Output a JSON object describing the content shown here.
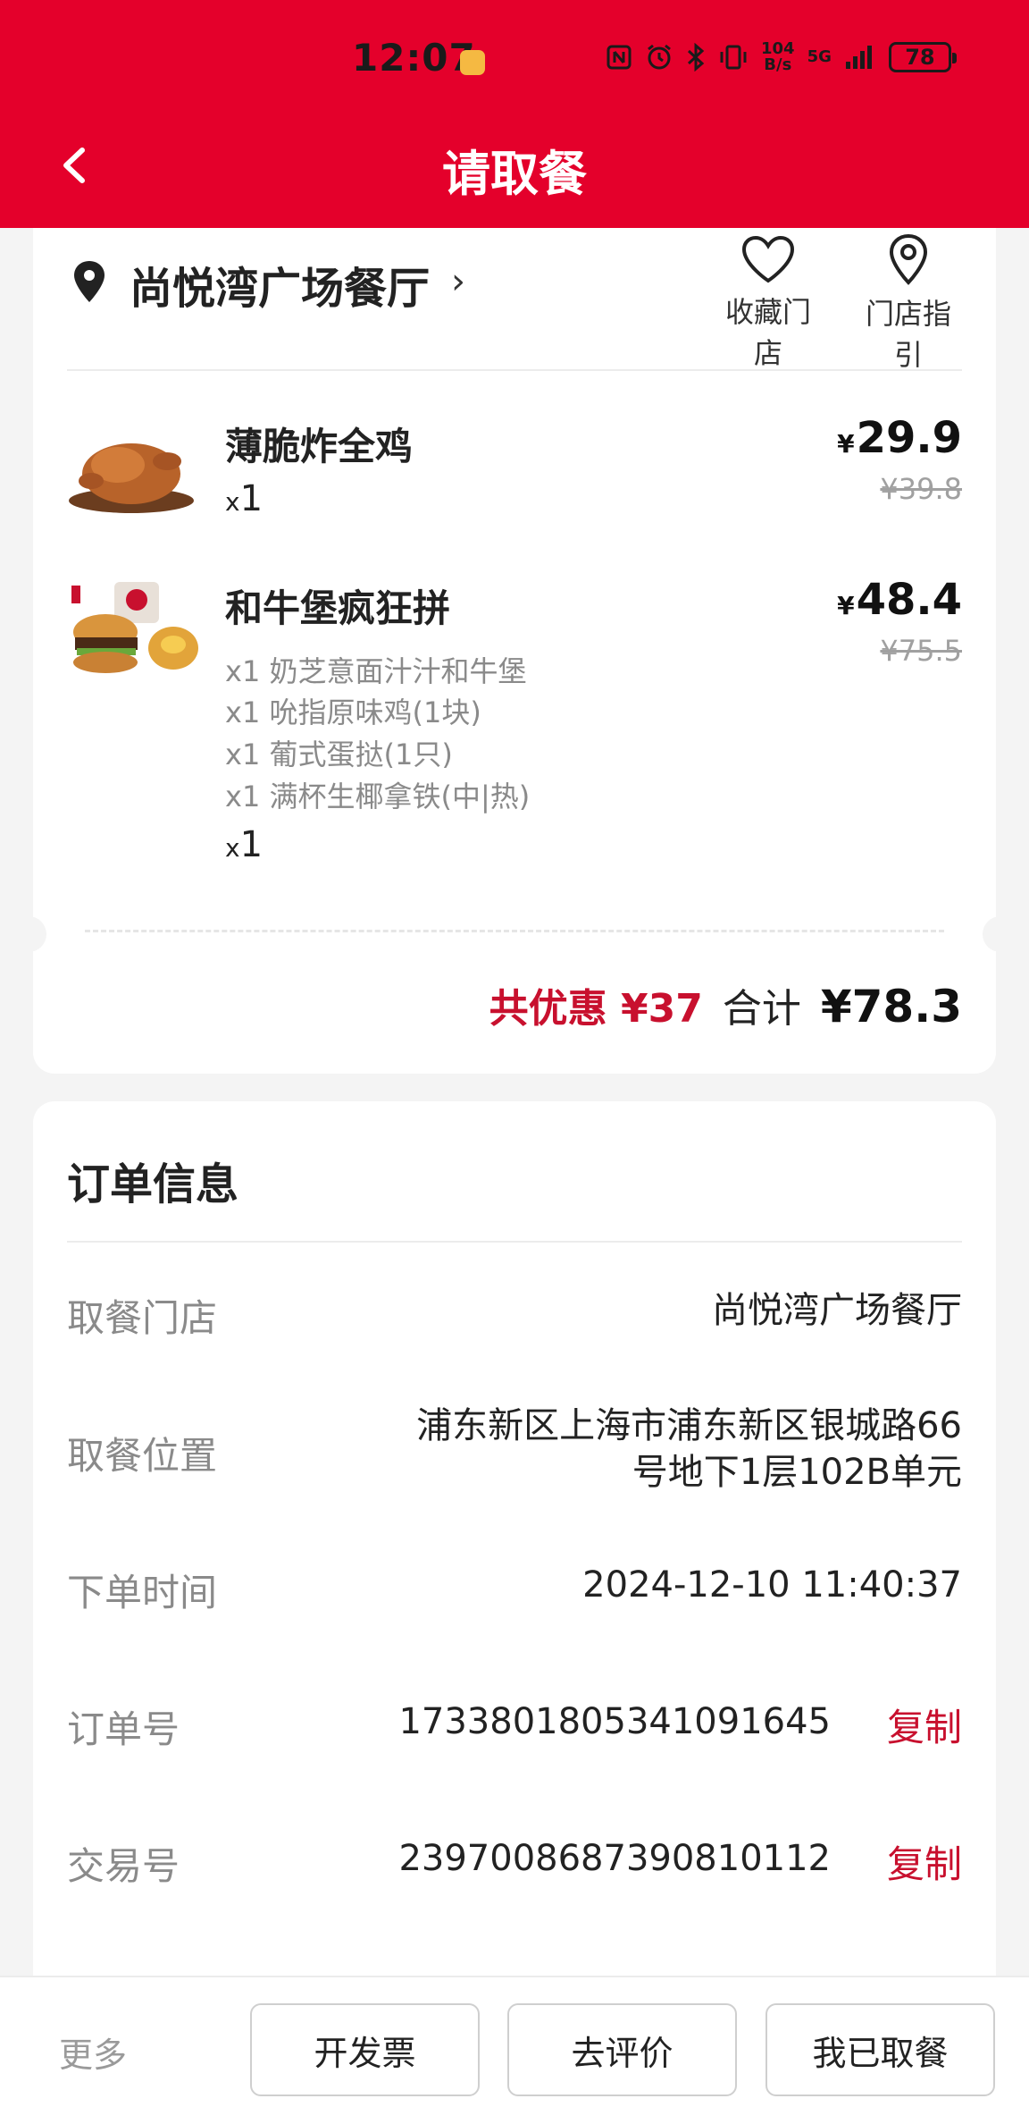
{
  "status_bar": {
    "time": "12:07",
    "net_speed_top": "104",
    "net_speed_unit": "B/s",
    "network": "5G",
    "battery": "78"
  },
  "nav": {
    "title": "请取餐"
  },
  "store": {
    "name": "尚悦湾广场餐厅",
    "favorite_label": "收藏门店",
    "guide_label": "门店指引"
  },
  "items": [
    {
      "name": "薄脆炸全鸡",
      "qty_prefix": "x",
      "qty": "1",
      "currency": "¥",
      "price": "29.9",
      "original_price": "¥39.8",
      "sub_items": []
    },
    {
      "name": "和牛堡疯狂拼",
      "qty_prefix": "x",
      "qty": "1",
      "currency": "¥",
      "price": "48.4",
      "original_price": "¥75.5",
      "sub_items": [
        "x1 奶芝意面汁汁和牛堡",
        "x1 吮指原味鸡(1块)",
        "x1 葡式蛋挞(1只)",
        "x1 满杯生椰拿铁(中|热)"
      ]
    }
  ],
  "summary": {
    "discount": "共优惠 ¥37",
    "total_label": "合计",
    "total": "¥78.3"
  },
  "order_info": {
    "title": "订单信息",
    "rows": [
      {
        "label": "取餐门店",
        "value": "尚悦湾广场餐厅"
      },
      {
        "label": "取餐位置",
        "value_line1": "浦东新区上海市浦东新区银城路66",
        "value_line2": "号地下1层102B单元"
      },
      {
        "label": "下单时间",
        "value": "2024-12-10 11:40:37"
      },
      {
        "label": "订单号",
        "value": "1733801805341091645",
        "action": "复制"
      },
      {
        "label": "交易号",
        "value": "2397008687390810112",
        "action": "复制"
      }
    ]
  },
  "bottom": {
    "more": "更多",
    "invoice": "开发票",
    "review": "去评价",
    "picked_up": "我已取餐"
  },
  "colors": {
    "brand_red": "#e4002b",
    "accent_red": "#c8102e",
    "muted": "#8a8a8a"
  }
}
